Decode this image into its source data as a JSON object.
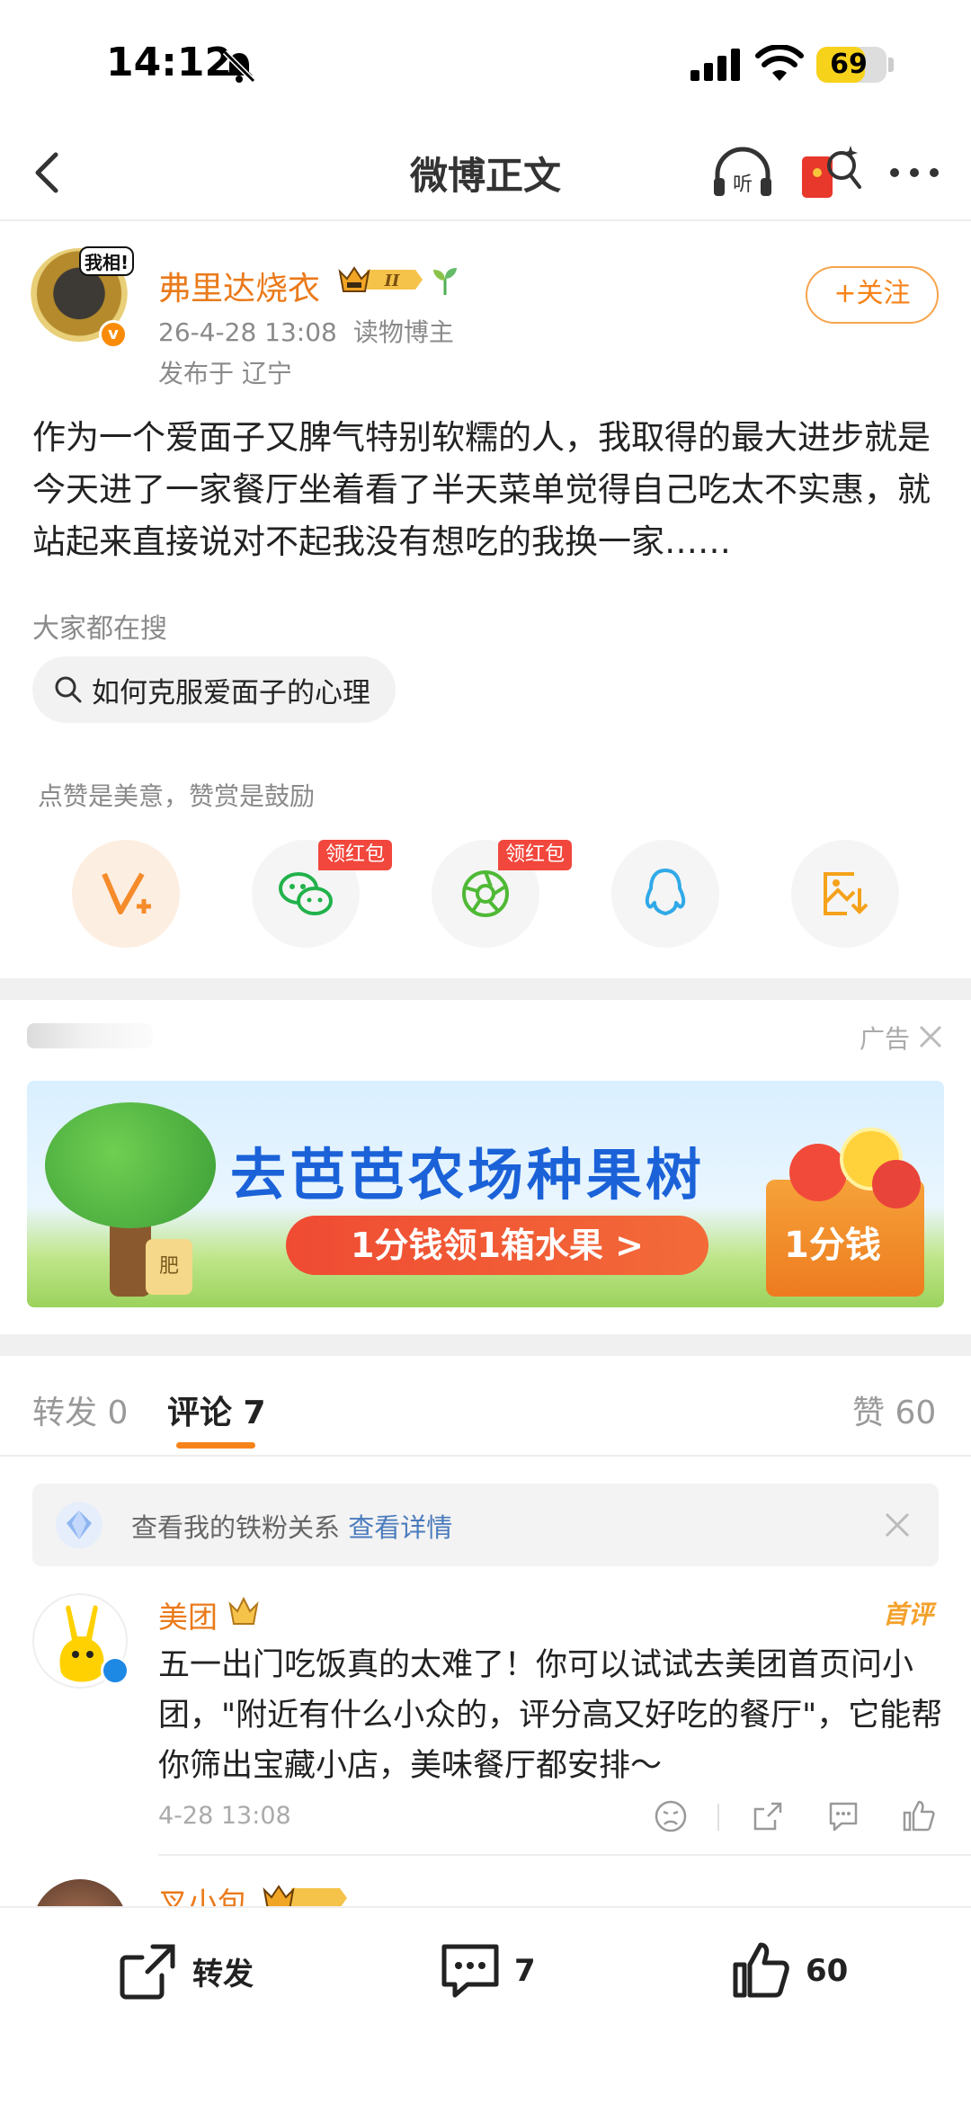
{
  "status_bar": {
    "time": "14:12",
    "battery": "69",
    "battery_level": 0.69
  },
  "nav": {
    "title": "微博正文"
  },
  "post": {
    "author": "弗里达烧衣",
    "avatar_tag": "我相!",
    "date": "26-4-28 13:08",
    "author_role": "读物博主",
    "location": "发布于 辽宁",
    "follow_label": "+关注",
    "text": "作为一个爱面子又脾气特别软糯的人，我取得的最大进步就是今天进了一家餐厅坐着看了半天菜单觉得自己吃太不实惠，就站起来直接说对不起我没有想吃的我换一家……"
  },
  "search": {
    "caption": "大家都在搜",
    "query": "如何克服爱面子的心理"
  },
  "reward": {
    "caption": "点赞是美意，赞赏是鼓励",
    "redpack_tag": "领红包"
  },
  "ad": {
    "label": "广告",
    "title": "去芭芭农场种果树",
    "pill": "1分钱领1箱水果 >",
    "box_text": "1分钱",
    "bag_text": "肥"
  },
  "tabs": {
    "repost": "转发 0",
    "comments": "评论 7",
    "likes": "赞 60"
  },
  "fan_notice": {
    "text": "查看我的铁粉关系 ",
    "link": "查看详情"
  },
  "comment": {
    "name": "美团",
    "first_tag": "首评",
    "text": "五一出门吃饭真的太难了！你可以试试去美团首页问小团，\"附近有什么小众的，评分高又好吃的餐厅\"，它能帮你筛出宝藏小店，美味餐厅都安排～",
    "time": "4-28 13:08"
  },
  "comment2": {
    "name": "叉小包"
  },
  "bottom": {
    "repost": "转发",
    "comments": "7",
    "likes": "60"
  },
  "colors": {
    "accent": "#f7831a",
    "name": "#ea7a1a",
    "link": "#4a7bbd"
  }
}
